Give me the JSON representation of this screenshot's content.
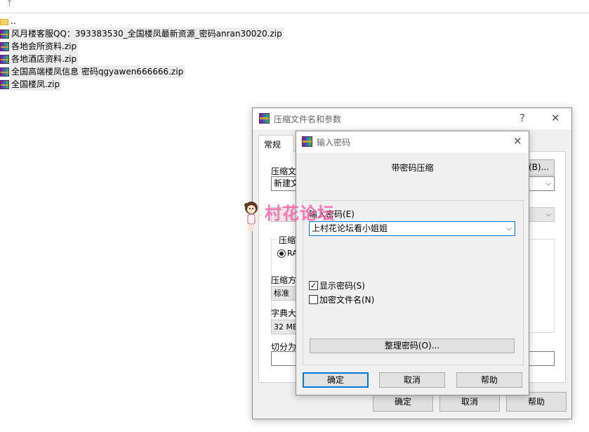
{
  "explorer": {
    "files": [
      {
        "name": "..",
        "type": "folder",
        "selected": false
      },
      {
        "name": "风月楼客服QQ：393383530_全国楼凤最新资源_密码anran30020.zip",
        "type": "rar",
        "selected": true
      },
      {
        "name": "各地会所资料.zip",
        "type": "rar",
        "selected": true
      },
      {
        "name": "各地酒店资料.zip",
        "type": "rar",
        "selected": true
      },
      {
        "name": "全国高端楼凤信息 密码qgyawen666666.zip",
        "type": "rar",
        "selected": true
      },
      {
        "name": "全国楼凤.zip",
        "type": "rar",
        "selected": true
      }
    ]
  },
  "archive_dialog": {
    "title": "压缩文件名和参数",
    "help_symbol": "?",
    "close_symbol": "✕",
    "tab_general": "常规",
    "archive_name_label": "压缩文",
    "archive_name_value": "新建文",
    "browse_button": "(B)...",
    "format_label": "压缩",
    "format_option": "RA",
    "method_label": "压缩方",
    "method_value": "标准",
    "dict_label": "字典大",
    "dict_value": "32 MB",
    "split_label": "切分为",
    "ok_button": "确定",
    "cancel_button": "取消",
    "help_button": "帮助"
  },
  "password_dialog": {
    "title": "输入密码",
    "close_symbol": "✕",
    "header": "带密码压缩",
    "enter_password_label": "输入密码(E)",
    "password_value": "上村花论坛看小姐姐",
    "show_password_label": "显示密码(S)",
    "show_password_checked": true,
    "encrypt_names_label": "加密文件名(N)",
    "encrypt_names_checked": false,
    "organize_button": "整理密码(O)...",
    "ok_button": "确定",
    "cancel_button": "取消",
    "help_button": "帮助"
  },
  "watermark": {
    "text": "村花论坛"
  },
  "colors": {
    "accent": "#0078d7",
    "watermark": "#ff5fa8"
  }
}
